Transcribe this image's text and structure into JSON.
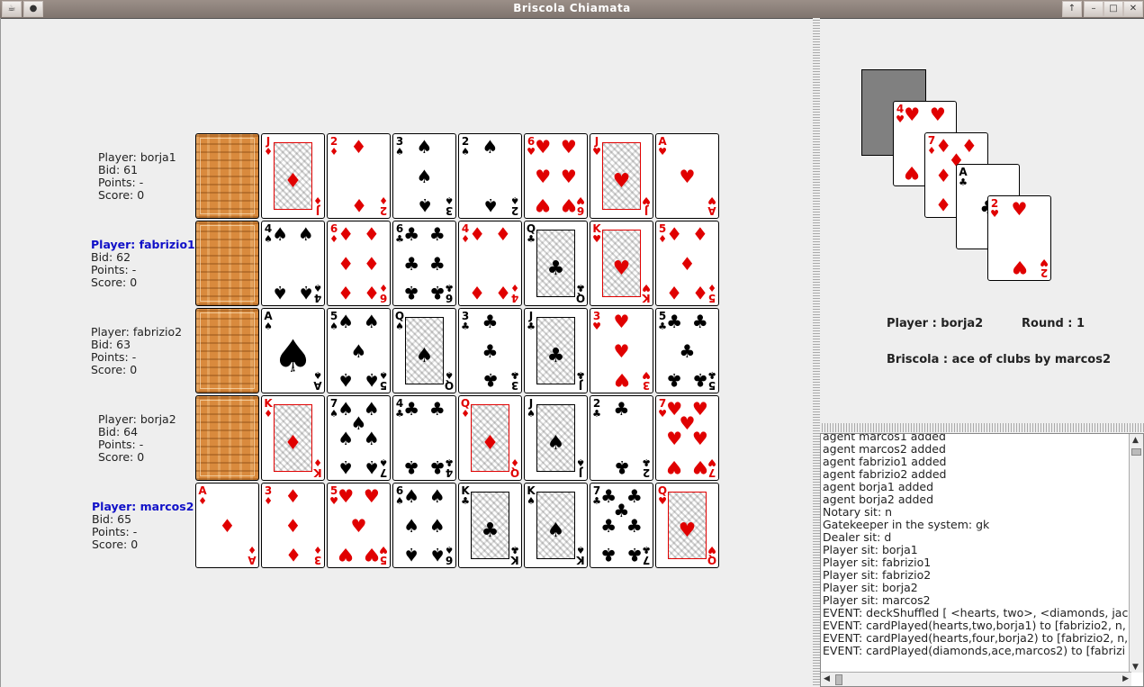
{
  "window": {
    "title": "Briscola Chiamata"
  },
  "players": [
    {
      "name": "Player: borja1",
      "bid": "Bid: 61",
      "points": "Points: -",
      "score": "Score: 0",
      "active": false
    },
    {
      "name": "Player: fabrizio1",
      "bid": "Bid: 62",
      "points": "Points: -",
      "score": "Score: 0",
      "active": true
    },
    {
      "name": "Player: fabrizio2",
      "bid": "Bid: 63",
      "points": "Points: -",
      "score": "Score: 0",
      "active": false
    },
    {
      "name": "Player: borja2",
      "bid": "Bid: 64",
      "points": "Points: -",
      "score": "Score: 0",
      "active": false
    },
    {
      "name": "Player: marcos2",
      "bid": "Bid: 65",
      "points": "Points: -",
      "score": "Score: 0",
      "active": true
    }
  ],
  "hands": [
    [
      "back",
      "J-diamonds",
      "2-diamonds",
      "3-spades",
      "2-spades",
      "6-hearts",
      "J-hearts",
      "A-hearts"
    ],
    [
      "back",
      "4-spades",
      "6-diamonds",
      "6-clubs",
      "4-diamonds",
      "Q-clubs",
      "K-hearts",
      "5-diamonds"
    ],
    [
      "back",
      "A-spades-gpl",
      "5-spades",
      "Q-spades",
      "3-clubs",
      "J-clubs",
      "3-hearts",
      "5-clubs"
    ],
    [
      "back",
      "K-diamonds",
      "7-spades",
      "4-clubs",
      "Q-diamonds",
      "J-spades",
      "2-clubs",
      "7-hearts"
    ],
    [
      "A-diamonds",
      "3-diamonds",
      "5-hearts",
      "6-spades",
      "K-clubs",
      "K-spades",
      "7-clubs",
      "Q-hearts"
    ]
  ],
  "table": {
    "played_cards": [
      "4-hearts",
      "7-diamonds",
      "A-clubs",
      "2-hearts"
    ],
    "player_label": "Player : borja2",
    "round_label": "Round : 1",
    "briscola_label": "Briscola : ace of clubs by marcos2"
  },
  "log": [
    "agent marcos1 added",
    "agent marcos2 added",
    "agent fabrizio1 added",
    "agent fabrizio2 added",
    "agent borja1 added",
    "agent borja2 added",
    "Notary sit: n",
    "Gatekeeper in the system: gk",
    "Dealer sit: d",
    "Player sit: borja1",
    "Player sit: fabrizio1",
    "Player sit: fabrizio2",
    "Player sit: borja2",
    "Player sit: marcos2",
    "EVENT: deckShuffled [ <hearts, two>, <diamonds, jack",
    "EVENT: cardPlayed(hearts,two,borja1) to [fabrizio2, n,",
    "EVENT: cardPlayed(hearts,four,borja2) to [fabrizio2, n,",
    "EVENT: cardPlayed(diamonds,ace,marcos2) to [fabrizi"
  ],
  "colors": {
    "red": "#e00000",
    "active_player": "#1010c8"
  },
  "icons": {
    "menu": "window-menu-icon",
    "pin": "pin-icon",
    "up": "arrow-up-icon",
    "minimize": "minimize-icon",
    "maximize": "maximize-icon",
    "close": "close-icon"
  }
}
